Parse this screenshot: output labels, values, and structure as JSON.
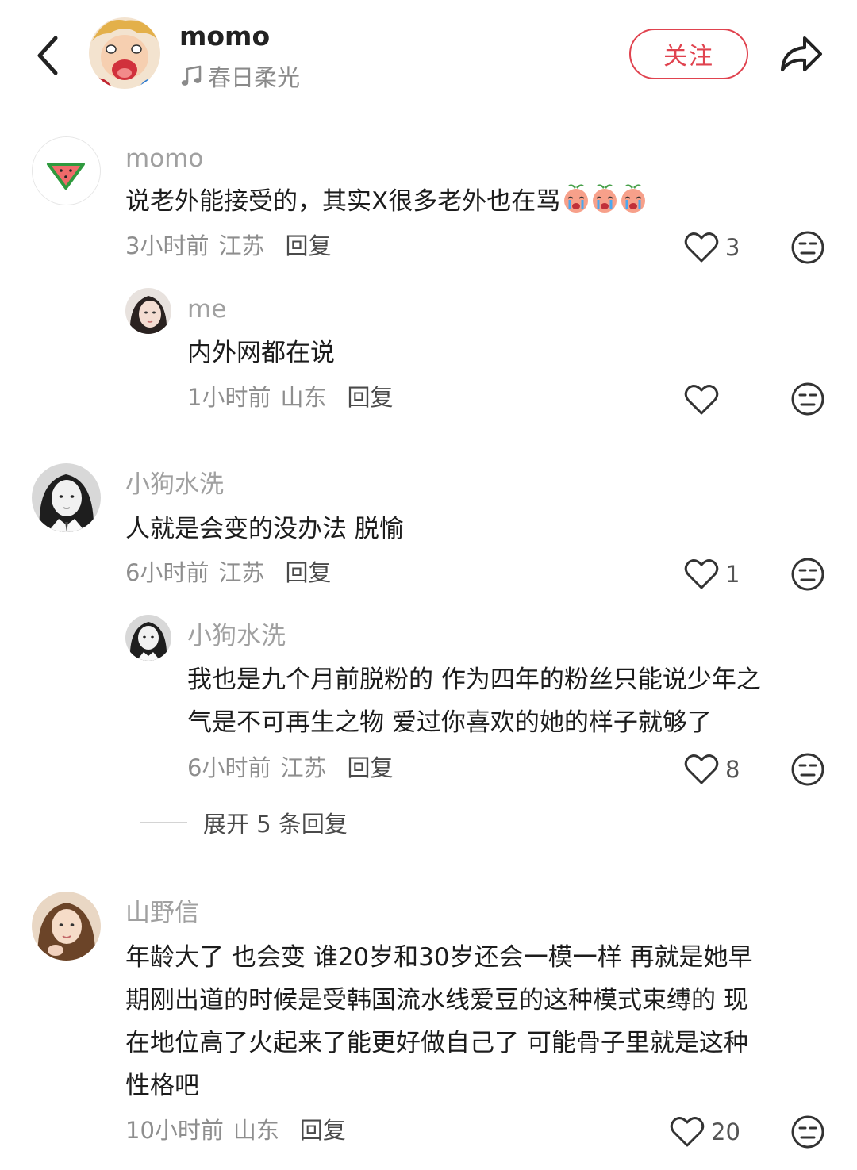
{
  "header": {
    "author": "momo",
    "music": "春日柔光",
    "follow_label": "关注"
  },
  "comments": [
    {
      "name": "momo",
      "text": "说老外能接受的，其实X很多老外也在骂",
      "emoji_icons": [
        "crying-peach-icon",
        "crying-peach-icon",
        "crying-peach-icon"
      ],
      "time": "3小时前",
      "location": "江苏",
      "reply_label": "回复",
      "likes": "3"
    },
    {
      "name": "me",
      "text": "内外网都在说",
      "time": "1小时前",
      "location": "山东",
      "reply_label": "回复",
      "likes": ""
    },
    {
      "name": "小狗水洗",
      "text": "人就是会变的没办法 脱愉",
      "time": "6小时前",
      "location": "江苏",
      "reply_label": "回复",
      "likes": "1"
    },
    {
      "name": "小狗水洗",
      "text_lines": [
        "我也是九个月前脱粉的 作为四年的粉丝只能说少年之",
        "气是不可再生之物 爱过你喜欢的她的样子就够了"
      ],
      "time": "6小时前",
      "location": "江苏",
      "reply_label": "回复",
      "likes": "8"
    },
    {
      "name": "山野信",
      "text_lines": [
        "年龄大了 也会变 谁20岁和30岁还会一模一样 再就是她早",
        "期刚出道的时候是受韩国流水线爱豆的这种模式束缚的 现",
        "在地位高了火起来了能更好做自己了 可能骨子里就是这种",
        "性格吧"
      ],
      "time": "10小时前",
      "location": "山东",
      "reply_label": "回复",
      "likes": "20"
    }
  ],
  "expand_label": "展开 5 条回复",
  "icons": {
    "back": "back-arrow-icon",
    "share": "share-arrow-icon",
    "music": "music-note-icon",
    "like": "heart-icon",
    "dislike": "neutral-face-icon"
  },
  "colors": {
    "accent": "#e0434f",
    "meta": "#8e8e8e",
    "name": "#a0a0a0"
  }
}
